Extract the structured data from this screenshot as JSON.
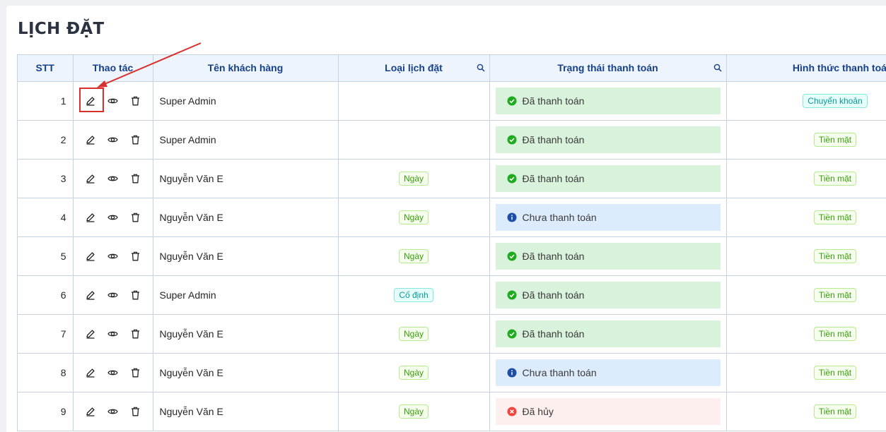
{
  "page": {
    "title": "LỊCH ĐẶT"
  },
  "table": {
    "columns": {
      "stt": "STT",
      "actions": "Thao tác",
      "customer": "Tên khách hàng",
      "booking_type": "Loại lịch đặt",
      "payment_status": "Trạng thái thanh toán",
      "payment_method": "Hình thức thanh toán"
    },
    "rows": [
      {
        "stt": "1",
        "customer": "Super Admin",
        "booking_type": "",
        "payment_status": "Đã thanh toán",
        "payment_method": "Chuyển khoản"
      },
      {
        "stt": "2",
        "customer": "Super Admin",
        "booking_type": "",
        "payment_status": "Đã thanh toán",
        "payment_method": "Tiền mặt"
      },
      {
        "stt": "3",
        "customer": "Nguyễn Văn E",
        "booking_type": "Ngày",
        "payment_status": "Đã thanh toán",
        "payment_method": "Tiền mặt"
      },
      {
        "stt": "4",
        "customer": "Nguyễn Văn E",
        "booking_type": "Ngày",
        "payment_status": "Chưa thanh toán",
        "payment_method": "Tiền mặt"
      },
      {
        "stt": "5",
        "customer": "Nguyễn Văn E",
        "booking_type": "Ngày",
        "payment_status": "Đã thanh toán",
        "payment_method": "Tiền mặt"
      },
      {
        "stt": "6",
        "customer": "Super Admin",
        "booking_type": "Cố định",
        "payment_status": "Đã thanh toán",
        "payment_method": "Tiền mặt"
      },
      {
        "stt": "7",
        "customer": "Nguyễn Văn E",
        "booking_type": "Ngày",
        "payment_status": "Đã thanh toán",
        "payment_method": "Tiền mặt"
      },
      {
        "stt": "8",
        "customer": "Nguyễn Văn E",
        "booking_type": "Ngày",
        "payment_status": "Chưa thanh toán",
        "payment_method": "Tiền mặt"
      },
      {
        "stt": "9",
        "customer": "Nguyễn Văn E",
        "booking_type": "Ngày",
        "payment_status": "Đã hủy",
        "payment_method": "Tiền mặt"
      }
    ]
  },
  "icons": {
    "edit": "edit-icon",
    "view": "eye-icon",
    "delete": "trash-icon",
    "search": "search-icon",
    "paid": "check-circle-icon",
    "unpaid": "info-circle-icon",
    "cancelled": "close-circle-icon"
  },
  "colors": {
    "header_text": "#16408a",
    "paid_bg": "#d9f2dc",
    "unpaid_bg": "#ddecfc",
    "cancel_bg": "#fdefed",
    "annotation": "#d9302c"
  }
}
